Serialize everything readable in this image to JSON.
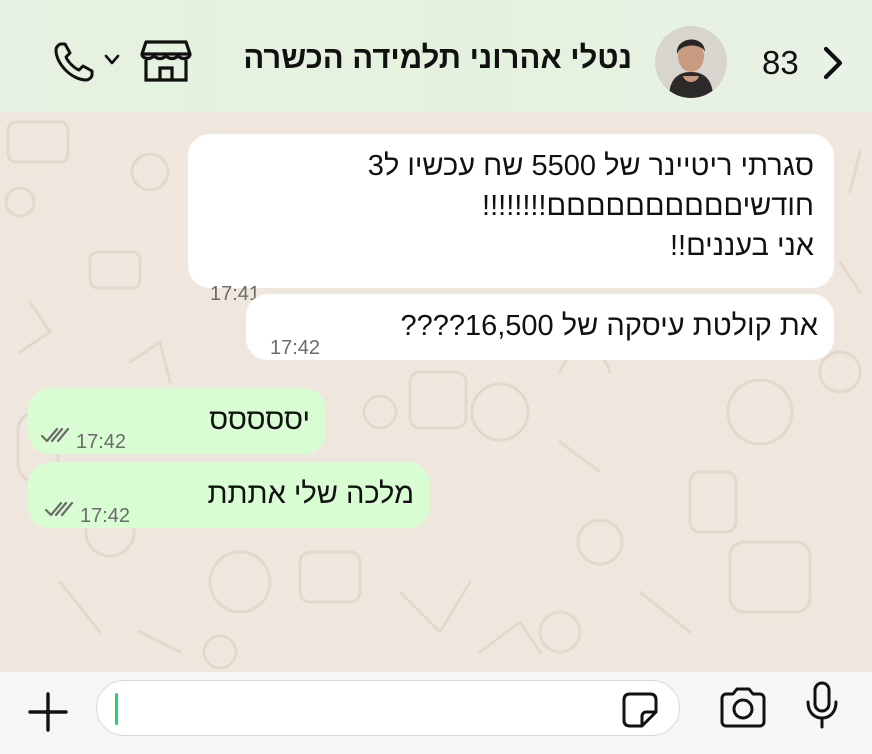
{
  "header": {
    "contact_name": "נטלי אהרוני תלמידה הכשרה",
    "unread_count": "83",
    "icons": [
      "chevron-left-icon",
      "avatar",
      "store-icon",
      "chevron-down-icon",
      "phone-icon"
    ]
  },
  "messages": [
    {
      "direction": "incoming",
      "text": "סגרתי ריטיינר של 5500 שח עכשיו ל3\nחודשיםםםםםםםםםם!!!!!!!!\nאני בעננים!!",
      "time": "17:41"
    },
    {
      "direction": "incoming",
      "text": "את קולטת עיסקה של 16,500????",
      "time": "17:42"
    },
    {
      "direction": "outgoing",
      "text": "יססססס",
      "time": "17:42",
      "status": "read-double-check"
    },
    {
      "direction": "outgoing",
      "text": "מלכה שלי אתתת",
      "time": "17:42",
      "status": "read-double-check"
    }
  ],
  "composer": {
    "input_value": "",
    "icons": [
      "plus-icon",
      "sticker-icon",
      "camera-icon",
      "microphone-icon"
    ]
  },
  "colors": {
    "header_bg": "#e3f2de",
    "incoming_bubble": "#ffffff",
    "outgoing_bubble": "#d9fdd3",
    "wallpaper": "#efe7dd",
    "accent": "#25d366"
  }
}
